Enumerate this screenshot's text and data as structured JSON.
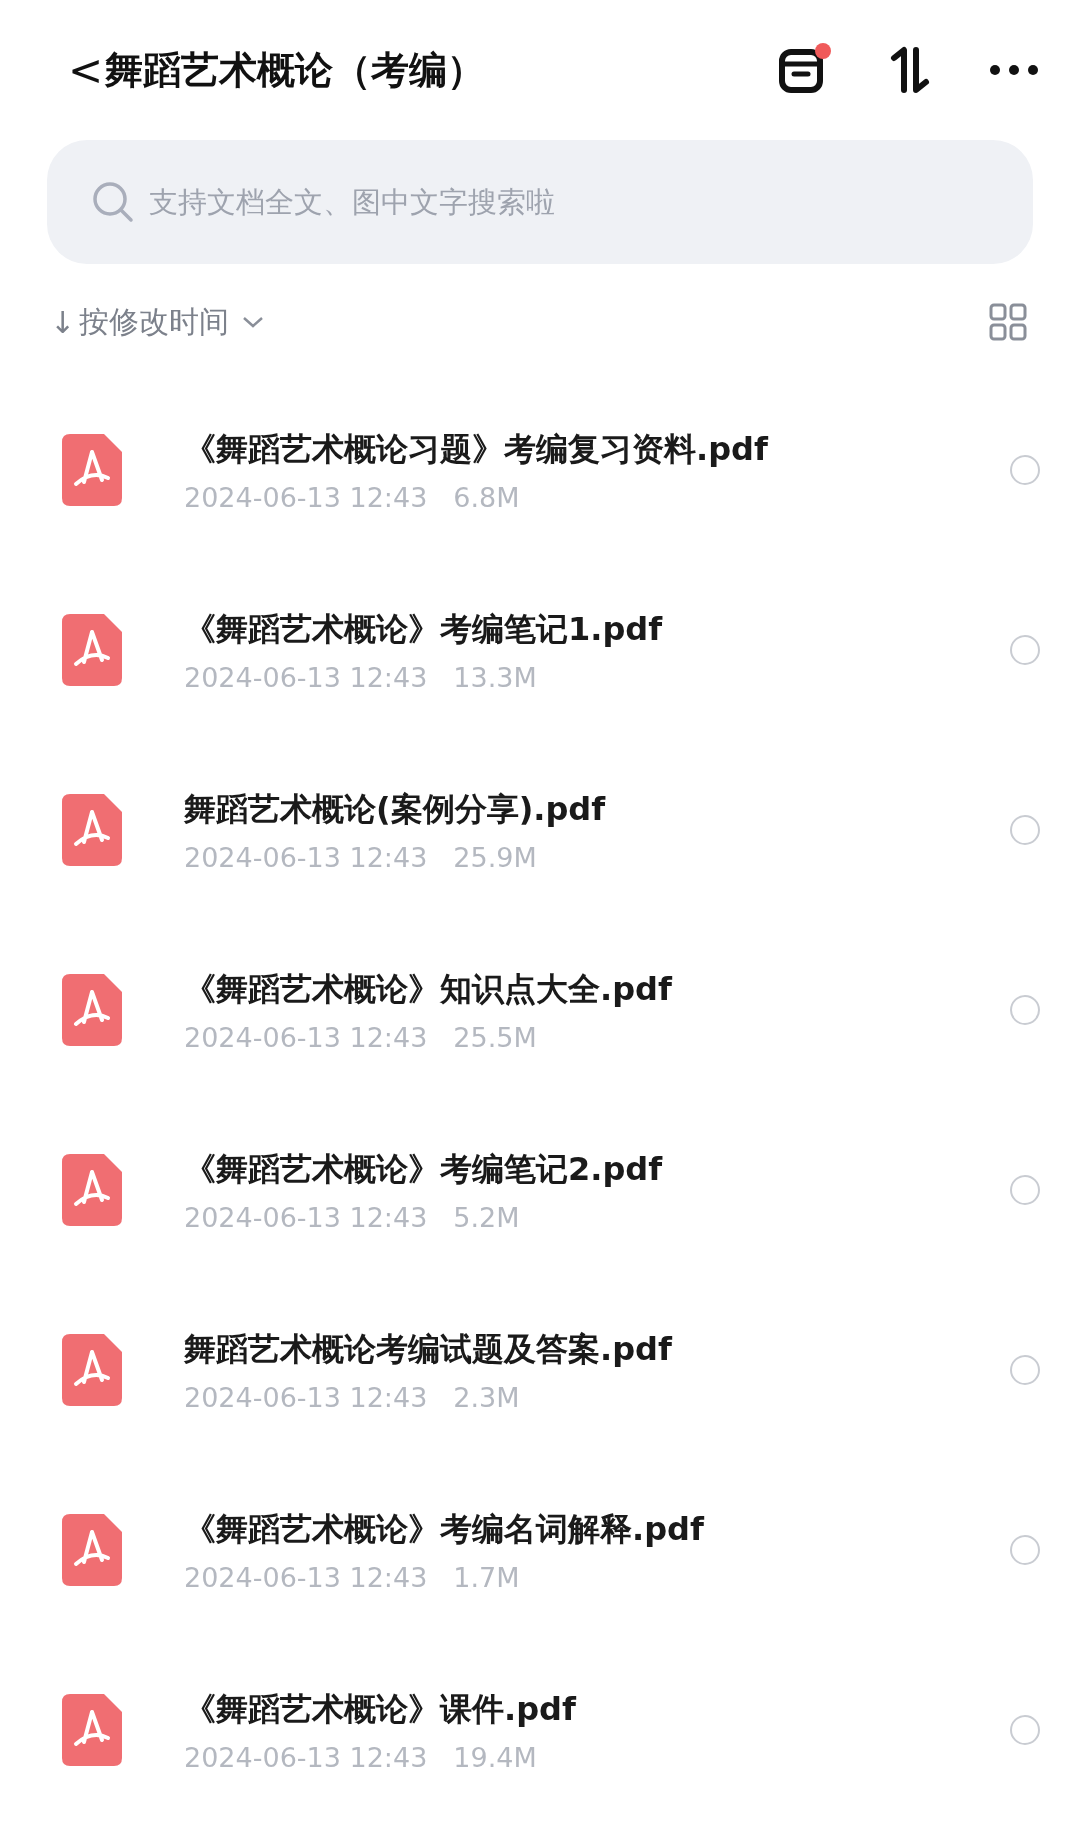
{
  "header": {
    "back": "<",
    "title": "舞蹈艺术概论（考编）",
    "notification_dot": true
  },
  "search": {
    "placeholder": "支持文档全文、图中文字搜索啦"
  },
  "sort": {
    "arrow": "↓",
    "label": "按修改时间"
  },
  "files": [
    {
      "name": "《舞蹈艺术概论习题》考编复习资料.pdf",
      "date": "2024-06-13 12:43",
      "size": "6.8M",
      "selected": false
    },
    {
      "name": "《舞蹈艺术概论》考编笔记1.pdf",
      "date": "2024-06-13 12:43",
      "size": "13.3M",
      "selected": false
    },
    {
      "name": "舞蹈艺术概论(案例分享).pdf",
      "date": "2024-06-13 12:43",
      "size": "25.9M",
      "selected": false
    },
    {
      "name": "《舞蹈艺术概论》知识点大全.pdf",
      "date": "2024-06-13 12:43",
      "size": "25.5M",
      "selected": false
    },
    {
      "name": "《舞蹈艺术概论》考编笔记2.pdf",
      "date": "2024-06-13 12:43",
      "size": "5.2M",
      "selected": false
    },
    {
      "name": "舞蹈艺术概论考编试题及答案.pdf",
      "date": "2024-06-13 12:43",
      "size": "2.3M",
      "selected": false
    },
    {
      "name": "《舞蹈艺术概论》考编名词解释.pdf",
      "date": "2024-06-13 12:43",
      "size": "1.7M",
      "selected": false
    },
    {
      "name": "《舞蹈艺术概论》课件.pdf",
      "date": "2024-06-13 12:43",
      "size": "19.4M",
      "selected": false
    }
  ]
}
